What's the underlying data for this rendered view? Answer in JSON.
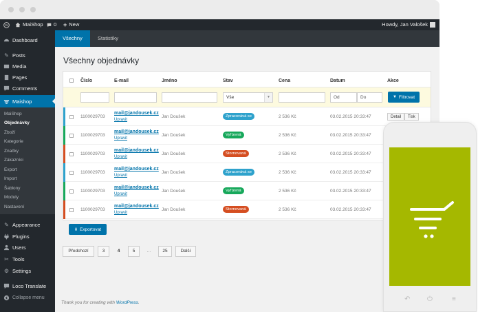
{
  "admin_bar": {
    "site_name": "MaiShop",
    "comments_count": "0",
    "new_label": "New",
    "howdy": "Howdy, Jan Valošek"
  },
  "sidebar": {
    "items": [
      {
        "label": "Dashboard",
        "icon": "dashboard-icon"
      },
      {
        "label": "Posts",
        "icon": "pin-icon"
      },
      {
        "label": "Media",
        "icon": "media-icon"
      },
      {
        "label": "Pages",
        "icon": "page-icon"
      },
      {
        "label": "Comments",
        "icon": "comment-icon"
      },
      {
        "label": "Maishop",
        "icon": "cart-icon"
      },
      {
        "label": "Appearance",
        "icon": "brush-icon"
      },
      {
        "label": "Plugins",
        "icon": "plug-icon"
      },
      {
        "label": "Users",
        "icon": "user-icon"
      },
      {
        "label": "Tools",
        "icon": "wrench-icon"
      },
      {
        "label": "Settings",
        "icon": "settings-icon"
      },
      {
        "label": "Loco Translate",
        "icon": "translate-icon"
      },
      {
        "label": "Collapse menu",
        "icon": "collapse-icon"
      }
    ],
    "submenu": [
      "MaiShop",
      "Objednávky",
      "Zboží",
      "Kategorie",
      "Značky",
      "Zákazníci",
      "Export",
      "Import",
      "Šablony",
      "Moduly",
      "Nastavení"
    ]
  },
  "tabs": [
    "Všechny",
    "Statistiky"
  ],
  "page_title": "Všechny objednávky",
  "table": {
    "headers": [
      "Číslo",
      "E-mail",
      "Jméno",
      "Stav",
      "Cena",
      "Datum",
      "Akce"
    ],
    "filter": {
      "status_value": "Vše",
      "date_from_placeholder": "Od",
      "date_to_placeholder": "Do",
      "filter_button": "Filtrovat"
    },
    "rows": [
      {
        "number": "1100029703",
        "email": "mail@jandousek.cz",
        "edit": "Upravit",
        "name": "Jan Doušek",
        "status": "Zpracovává se",
        "price": "2 536 Kč",
        "date": "03.02.2015 20:33:47"
      },
      {
        "number": "1100029703",
        "email": "mail@jandousek.cz",
        "edit": "Upravit",
        "name": "Jan Doušek",
        "status": "Vyřízená",
        "price": "2 536 Kč",
        "date": "03.02.2015 20:33:47"
      },
      {
        "number": "1100029703",
        "email": "mail@jandousek.cz",
        "edit": "Upravit",
        "name": "Jan Doušek",
        "status": "Stornovaná",
        "price": "2 536 Kč",
        "date": "03.02.2015 20:33:47"
      },
      {
        "number": "1100029703",
        "email": "mail@jandousek.cz",
        "edit": "Upravit",
        "name": "Jan Doušek",
        "status": "Zpracovává se",
        "price": "2 536 Kč",
        "date": "03.02.2015 20:33:47"
      },
      {
        "number": "1100029703",
        "email": "mail@jandousek.cz",
        "edit": "Upravit",
        "name": "Jan Doušek",
        "status": "Vyřízená",
        "price": "2 536 Kč",
        "date": "03.02.2015 20:33:47"
      },
      {
        "number": "1100029703",
        "email": "mail@jandousek.cz",
        "edit": "Upravit",
        "name": "Jan Doušek",
        "status": "Stornovaná",
        "price": "2 536 Kč",
        "date": "03.02.2015 20:33:47"
      }
    ],
    "actions": [
      "Detail",
      "Tisk"
    ],
    "export_button": "Exportovat"
  },
  "pagination": {
    "prev": "Předchozí",
    "pages": [
      "3",
      "4",
      "5",
      "...",
      "25"
    ],
    "current": "4",
    "next": "Další"
  },
  "footer": {
    "text": "Thank you for creating with ",
    "link": "WordPress",
    "end": "."
  },
  "colors": {
    "accent": "#0073aa",
    "admin_dark": "#23282d",
    "status_processing": "#2ea2cc",
    "status_done": "#17a85b",
    "status_cancelled": "#d54e21",
    "phone_screen": "#a5b800"
  }
}
